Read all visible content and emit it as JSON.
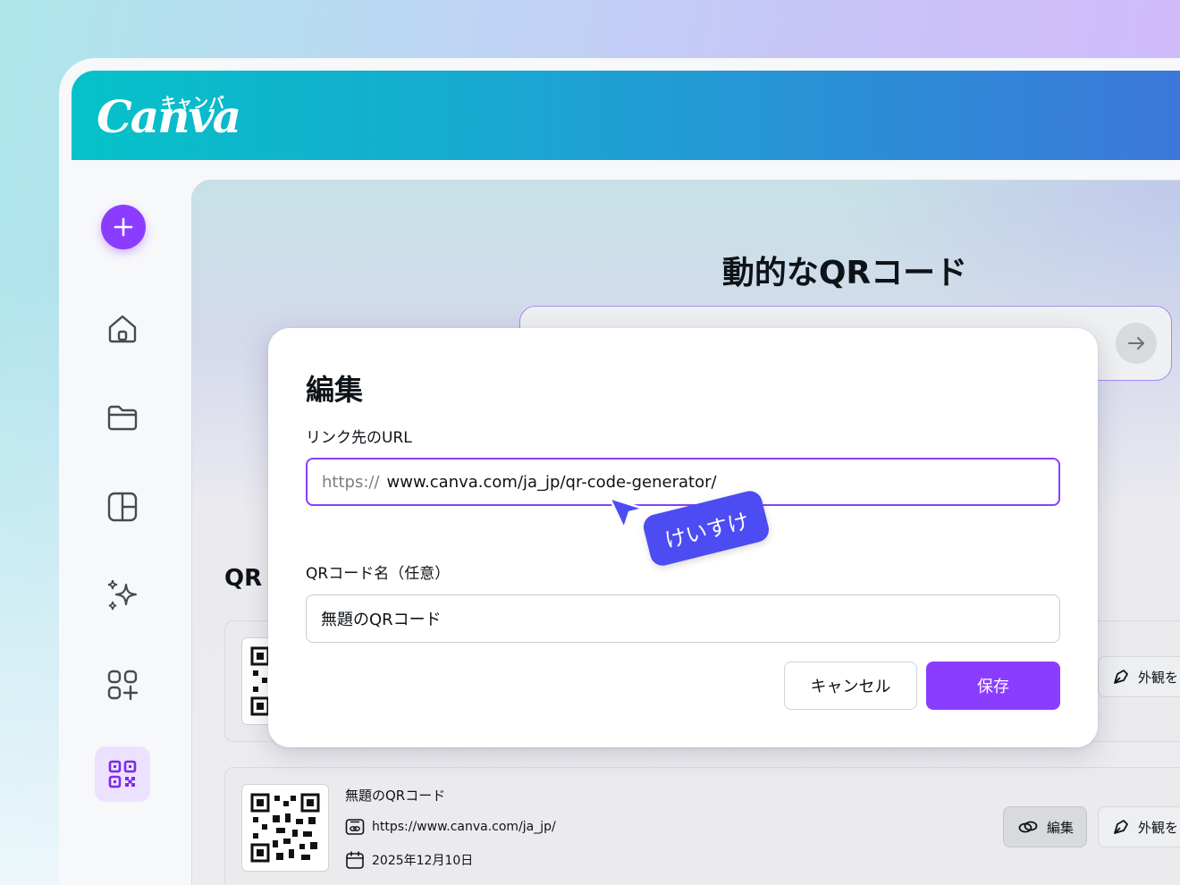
{
  "brand": {
    "logo_text": "Canva",
    "logo_kana": "キャンバ"
  },
  "sidebar": {
    "items": [
      {
        "name": "create",
        "icon": "plus-icon"
      },
      {
        "name": "home",
        "icon": "home-icon"
      },
      {
        "name": "projects",
        "icon": "folder-icon"
      },
      {
        "name": "templates",
        "icon": "layout-icon"
      },
      {
        "name": "magic",
        "icon": "sparkles-icon"
      },
      {
        "name": "apps",
        "icon": "apps-add-icon"
      },
      {
        "name": "qr-code",
        "icon": "qr-icon",
        "active": true
      }
    ]
  },
  "main": {
    "title": "動的なQRコード",
    "list_title": "QR"
  },
  "cards": [
    {
      "appearance_label": "外観を"
    },
    {
      "name": "無題のQRコード",
      "url": "https://www.canva.com/ja_jp/",
      "date": "2025年12月10日",
      "edit_label": "編集",
      "appearance_label": "外観を"
    }
  ],
  "modal": {
    "title": "編集",
    "url_label": "リンク先のURL",
    "url_prefix": "https://",
    "url_value": "www.canva.com/ja_jp/qr-code-generator/",
    "name_label": "QRコード名（任意）",
    "name_value": "無題のQRコード",
    "cancel_label": "キャンセル",
    "save_label": "保存"
  },
  "collaborator": {
    "name": "けいすけ"
  },
  "colors": {
    "accent": "#8b3dff",
    "cursor": "#4d4cf2",
    "header_start": "#05c2c8",
    "header_end": "#3d76da"
  }
}
